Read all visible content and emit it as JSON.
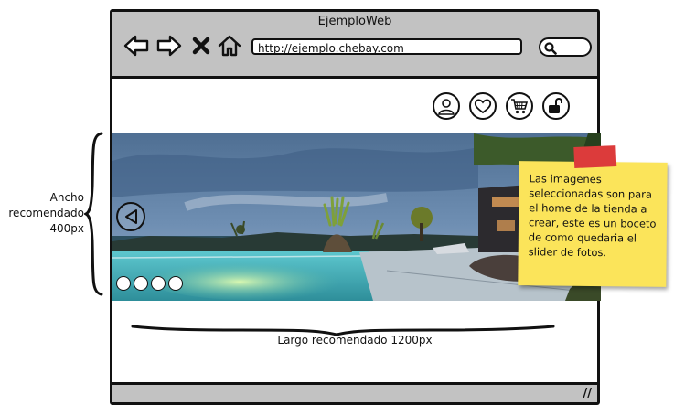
{
  "annotations": {
    "height_label": [
      "Ancho",
      "recomendado",
      "400px"
    ],
    "width_label": "Largo recomendado 1200px",
    "sticky_note": "Las imagenes seleccionadas son para el home de la tienda a crear, este es un boceto de como quedaria el slider de fotos."
  },
  "window": {
    "title": "EjemploWeb",
    "url": "http://ejemplo.chebay.com"
  },
  "toolbar": {
    "nav_icons": [
      "back-arrow-icon",
      "forward-arrow-icon",
      "close-x-icon",
      "home-icon"
    ]
  },
  "header_icons": [
    "user-icon",
    "heart-icon",
    "cart-icon",
    "unlock-icon"
  ],
  "slider": {
    "image": "resort-infinity-pool-at-dusk",
    "dots": 4,
    "prev_icon": "play-left-icon"
  },
  "colors": {
    "chrome": "#c2c2c2",
    "sticky": "#fbe45a",
    "tape": "#dc3b3b"
  }
}
